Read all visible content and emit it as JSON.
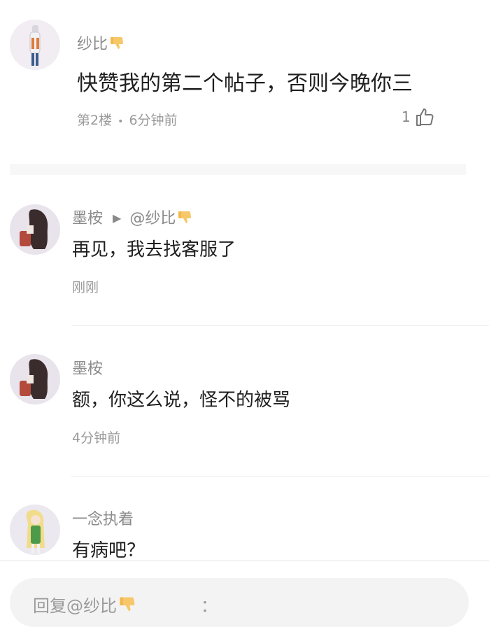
{
  "colors": {
    "text_primary": "#1f1f1f",
    "text_secondary": "#8a8a8a",
    "divider": "#ececec",
    "thumb_icon": "#f3c765"
  },
  "main_post": {
    "author": "纱比",
    "author_icon": "thumbs-down-icon",
    "content": "快赞我的第二个帖子，否则今晚你三",
    "floor": "第2楼",
    "separator": "•",
    "time": "6分钟前",
    "like_count": "1",
    "like_icon": "thumbs-up-icon"
  },
  "replies": [
    {
      "author": "墨桉",
      "reply_arrow": "▶",
      "reply_to": "@纱比",
      "reply_to_icon": "thumbs-down-icon",
      "content": "再见，我去找客服了",
      "time": "刚刚"
    },
    {
      "author": "墨桉",
      "content": "额，你这么说，怪不的被骂",
      "time": "4分钟前"
    },
    {
      "author": "一念执着",
      "content": "有病吧？"
    }
  ],
  "reply_bar": {
    "placeholder": "回复@纱比",
    "placeholder_icon": "thumbs-down-icon",
    "trailing": "："
  }
}
